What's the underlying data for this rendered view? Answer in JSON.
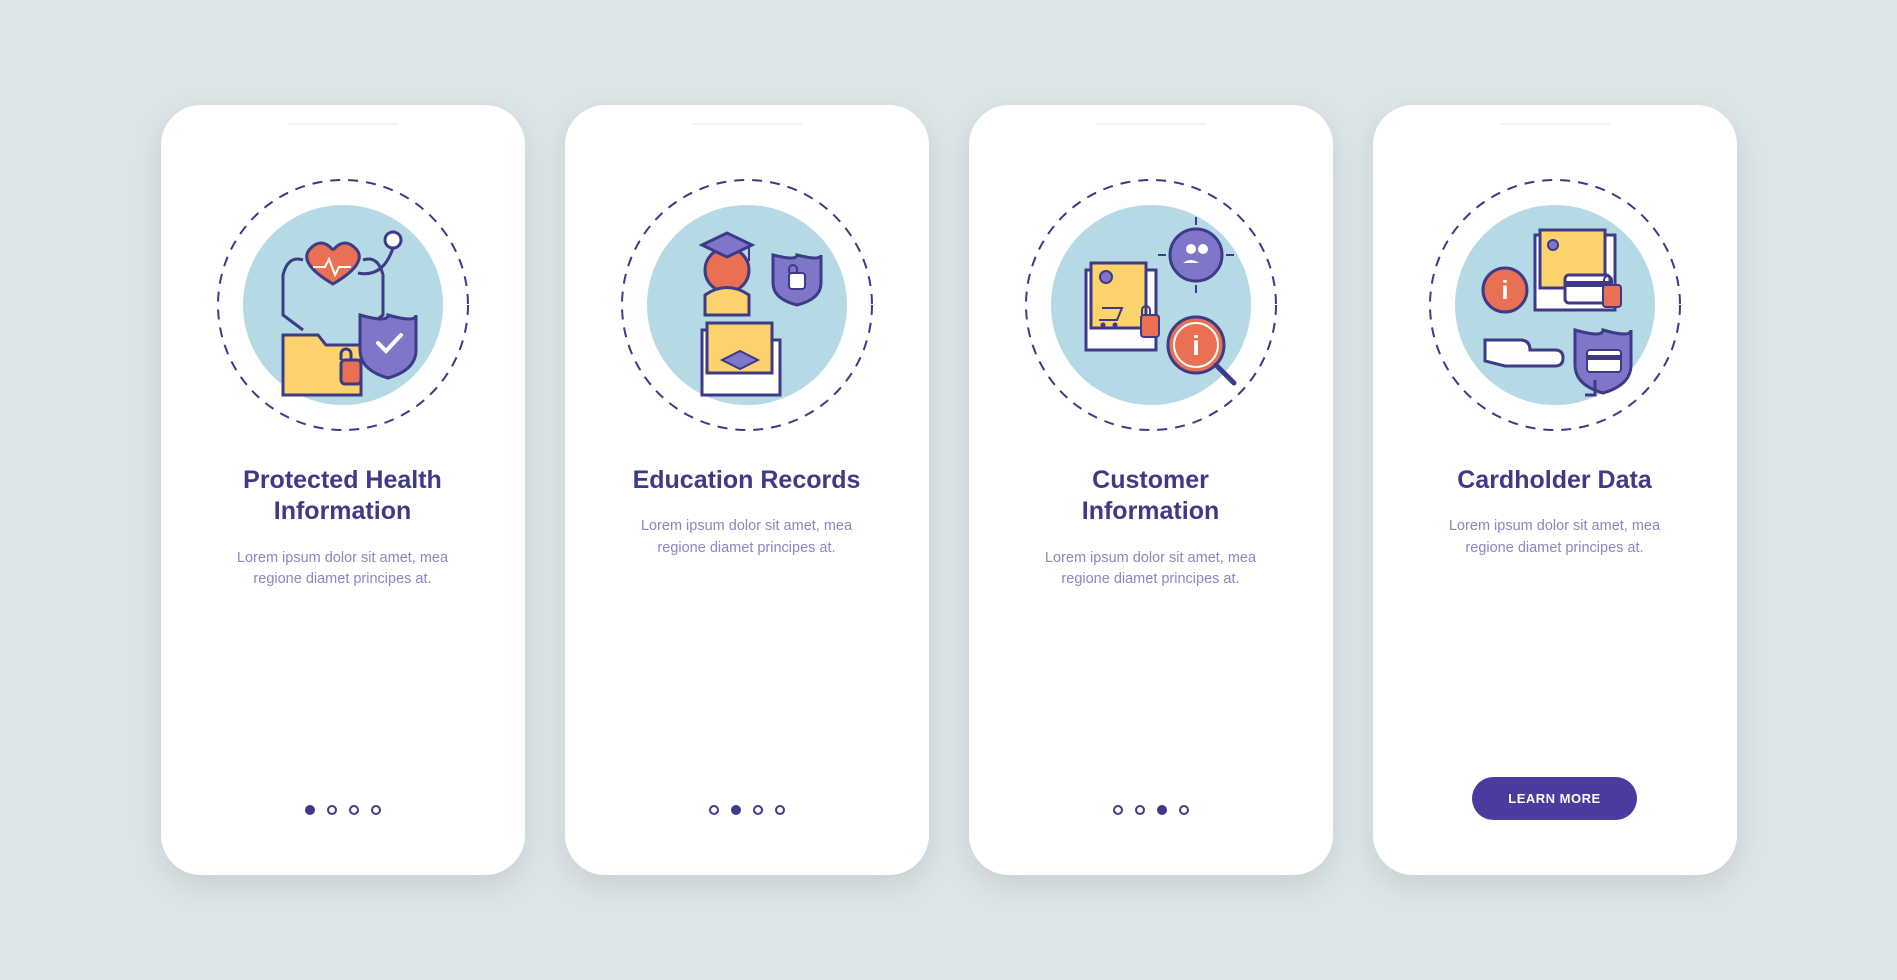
{
  "colors": {
    "primary": "#3d3a87",
    "accent": "#e97052",
    "yellow": "#fbd26b",
    "lightblue": "#b6d9e6"
  },
  "cards": [
    {
      "title": "Protected Health Information",
      "desc": "Lorem ipsum dolor sit amet, mea regione diamet principes at.",
      "active": 0
    },
    {
      "title": "Education Records",
      "desc": "Lorem ipsum dolor sit amet, mea regione diamet principes at.",
      "active": 1
    },
    {
      "title": "Customer Information",
      "desc": "Lorem ipsum dolor sit amet, mea regione diamet principes at.",
      "active": 2
    },
    {
      "title": "Cardholder Data",
      "desc": "Lorem ipsum dolor sit amet, mea regione diamet principes at.",
      "active": 3,
      "cta": "LEARN MORE"
    }
  ]
}
